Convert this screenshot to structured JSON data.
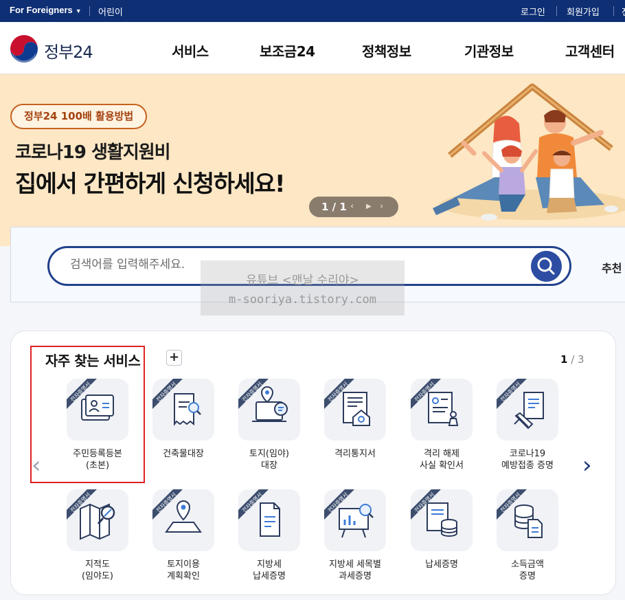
{
  "topbar": {
    "lang_label": "For Foreigners",
    "kids_label": "어린이",
    "login_label": "로그인",
    "join_label": "회원가입",
    "more_label": "전"
  },
  "header": {
    "logo_text": "정부24",
    "nav": [
      "서비스",
      "보조금24",
      "정책정보",
      "기관정보",
      "고객센터"
    ]
  },
  "hero": {
    "pill": "정부24 100배 활용방법",
    "line1": "코로나19 생활지원비",
    "line2": "집에서 간편하게 신청하세요!",
    "pager_count": "1 / 1",
    "prev_glyph": "‹",
    "play_glyph": "▶",
    "next_glyph": "›"
  },
  "search": {
    "placeholder": "검색어를 입력해주세요.",
    "recommend_label": "추천"
  },
  "watermark": {
    "line1": "유튜브 <맨날 수리야>",
    "line2": "m-sooriya.tistory.com"
  },
  "services": {
    "title": "자주 찾는 서비스",
    "add_glyph": "+",
    "page_current": "1",
    "page_total": " / 3",
    "badge": "전자증명서",
    "prev_glyph": "‹",
    "next_glyph": "›",
    "items": [
      {
        "label": "주민등록등본\n(초본)",
        "icon": "id-card-icon"
      },
      {
        "label": "건축물대장",
        "icon": "receipt-search-icon"
      },
      {
        "label": "토지(임야)\n대장",
        "icon": "laptop-location-icon"
      },
      {
        "label": "격리통지서",
        "icon": "document-house-icon"
      },
      {
        "label": "격리 해제\n사실 확인서",
        "icon": "document-stamp-icon"
      },
      {
        "label": "코로나19\n예방접종 증명",
        "icon": "document-syringe-icon"
      },
      {
        "label": "지적도\n(임야도)",
        "icon": "map-search-icon"
      },
      {
        "label": "토지이용\n계획확인",
        "icon": "map-pin-icon"
      },
      {
        "label": "지방세\n납세증명",
        "icon": "document-icon"
      },
      {
        "label": "지방세 세목별\n과세증명",
        "icon": "chart-board-icon"
      },
      {
        "label": "납세증명",
        "icon": "document-coins-icon"
      },
      {
        "label": "소득금액\n증명",
        "icon": "coins-document-icon"
      }
    ]
  },
  "colors": {
    "topbar": "#0e2f74",
    "hero_bg": "#fde7c4",
    "search_border": "#21418b",
    "badge": "#3d4e6e",
    "highlight": "#e02020"
  }
}
